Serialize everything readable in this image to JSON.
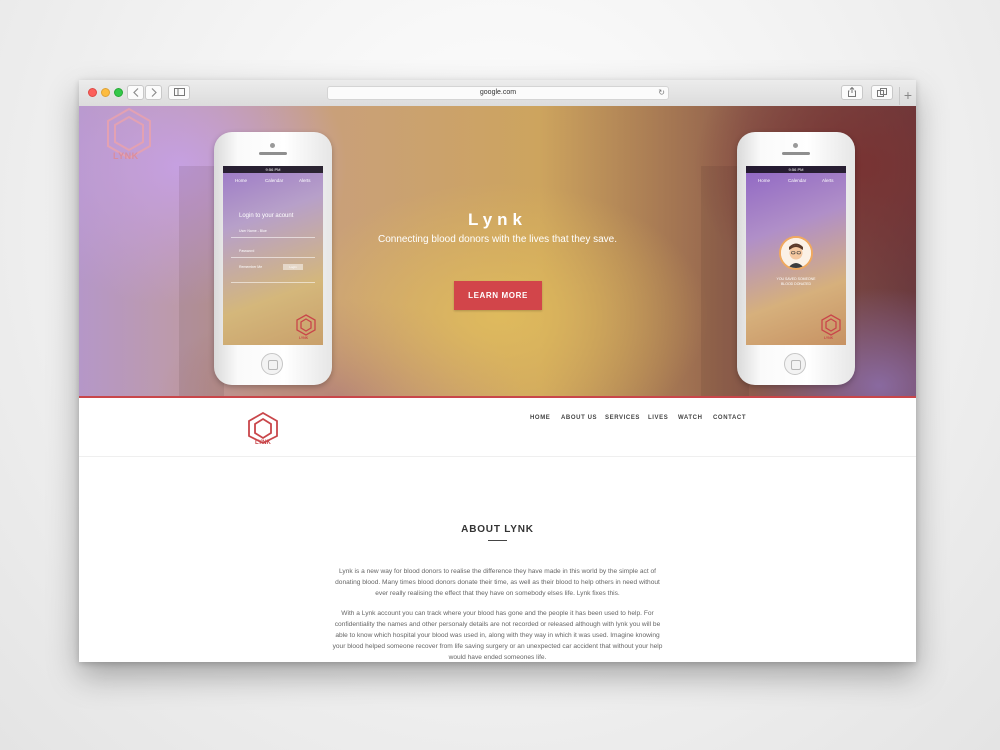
{
  "browser": {
    "url": "google.com",
    "back_icon": "chevron-left-icon",
    "forward_icon": "chevron-right-icon",
    "sidebar_icon": "sidebar-icon",
    "reload_icon": "reload-icon",
    "share_icon": "share-icon",
    "tabs_icon": "tabs-icon",
    "new_tab_label": "+"
  },
  "hero": {
    "logo_text": "LYNK",
    "title": "Lynk",
    "subtitle": "Connecting blood donors with the lives that they save.",
    "cta_label": "LEARN MORE",
    "accent_color": "#d2454a"
  },
  "phone_left": {
    "time": "9:56 PM",
    "nav": [
      "Home",
      "Calendar",
      "Alerts"
    ],
    "heading": "Login to your acount",
    "field1_label": "User Name - Blue",
    "field2_label": "Password",
    "remember_label": "Remember Me",
    "login_label": "Login",
    "logo_text": "LYNK"
  },
  "phone_right": {
    "time": "9:56 PM",
    "nav": [
      "Home",
      "Calendar",
      "Alerts"
    ],
    "caption_line1": "YOU SAVED SOMEONE",
    "caption_line2": "BLOOD DONATED",
    "logo_text": "LYNK"
  },
  "nav": {
    "logo_text": "LYNK",
    "items": [
      "HOME",
      "ABOUT US",
      "SERVICES",
      "LIVES",
      "WATCH",
      "CONTACT"
    ]
  },
  "about": {
    "title": "ABOUT LYNK",
    "paragraph1": "Lynk is a new way for blood donors to realise the difference they have made in this world by the simple act of donating blood. Many times blood donors donate their time, as well as their blood to help others in need without ever really realising the effect that they have on somebody elses life. Lynk fixes this.",
    "paragraph2": "With a Lynk account you can track where your blood has gone and the people it has been used to help. For confidentiality the names and other personaly details are not recorded or released although with lynk you will be able to know which hospital your blood was used in, along with they way in which it was used. Imagine knowing your blood helped someone recover from life saving surgery or an unexpected car accident that without your help would have ended someones life."
  }
}
